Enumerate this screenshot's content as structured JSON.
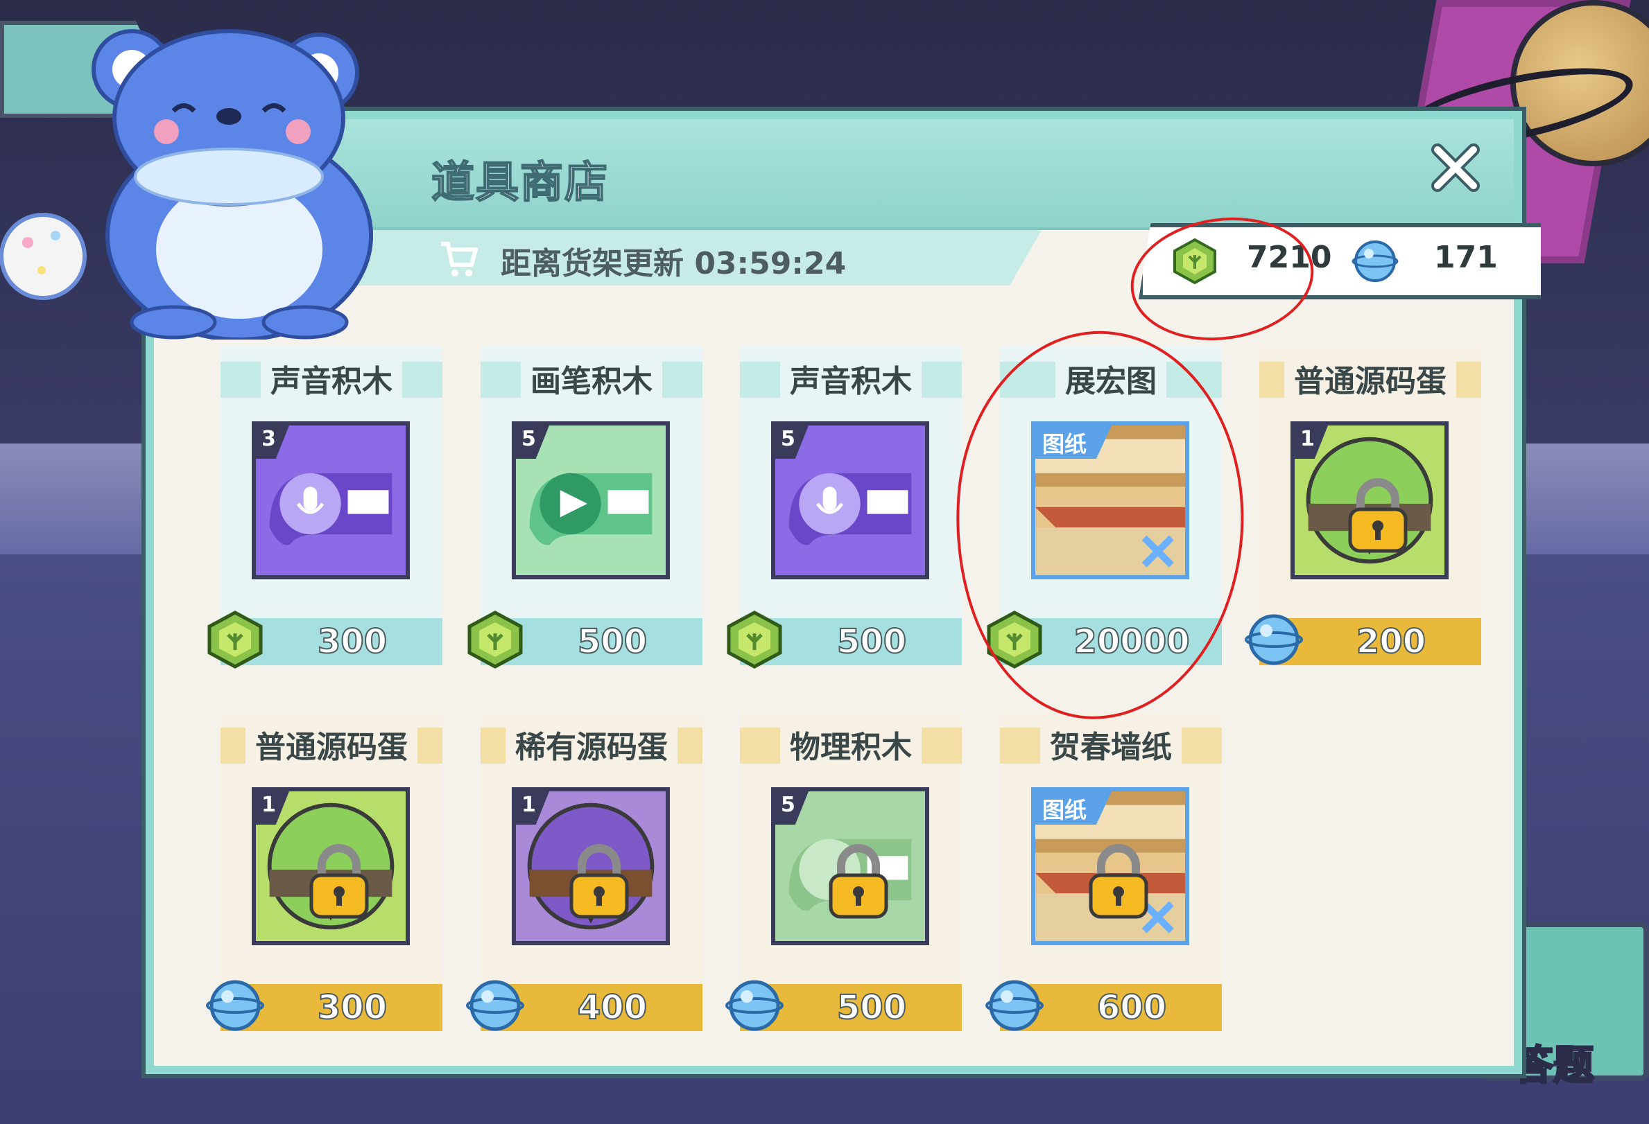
{
  "shop": {
    "title": "道具商店",
    "refresh_text": "距离货架更新 03:59:24"
  },
  "currency": {
    "gems": "7210",
    "orbs": "171"
  },
  "items": [
    {
      "name": "声音积木",
      "qty": "3",
      "price": "300",
      "currency": "gem",
      "style": "teal",
      "art": "sound",
      "locked": false
    },
    {
      "name": "画笔积木",
      "qty": "5",
      "price": "500",
      "currency": "gem",
      "style": "teal",
      "art": "pen",
      "locked": false
    },
    {
      "name": "声音积木",
      "qty": "5",
      "price": "500",
      "currency": "gem",
      "style": "teal",
      "art": "sound",
      "locked": false
    },
    {
      "name": "展宏图",
      "tag": "图纸",
      "price": "20000",
      "currency": "gem",
      "style": "teal",
      "art": "blueprint",
      "locked": false
    },
    {
      "name": "普通源码蛋",
      "qty": "1",
      "price": "200",
      "currency": "orb",
      "style": "yellow",
      "art": "egg-green",
      "locked": true
    },
    {
      "name": "普通源码蛋",
      "qty": "1",
      "price": "300",
      "currency": "orb",
      "style": "yellow",
      "art": "egg-green",
      "locked": true
    },
    {
      "name": "稀有源码蛋",
      "qty": "1",
      "price": "400",
      "currency": "orb",
      "style": "yellow",
      "art": "egg-purple",
      "locked": true
    },
    {
      "name": "物理积木",
      "qty": "5",
      "price": "500",
      "currency": "orb",
      "style": "yellow",
      "art": "physics",
      "locked": true
    },
    {
      "name": "贺春墙纸",
      "tag": "图纸",
      "price": "600",
      "currency": "orb",
      "style": "yellow",
      "art": "blueprint",
      "locked": true
    }
  ],
  "background": {
    "corner_label": "答题"
  },
  "colors": {
    "panel": "#f4f2ea",
    "header": "#a9e3dc",
    "gem_price_bar": "#a6dfe0",
    "orb_price_bar": "#e8b93a",
    "annotation": "#e02020"
  },
  "icons": {
    "gem": "green-gem-icon",
    "orb": "blue-orb-icon",
    "close": "close-icon",
    "cart": "cart-icon",
    "lock": "lock-icon"
  }
}
